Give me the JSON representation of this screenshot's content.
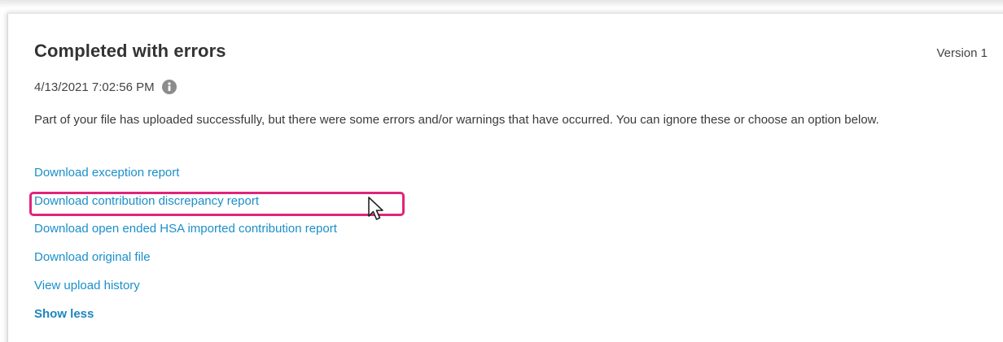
{
  "card": {
    "title": "Completed with errors",
    "version": "Version 1",
    "timestamp": "4/13/2021 7:02:56 PM",
    "info_icon": "info-circle-icon",
    "message": "Part of your file has uploaded successfully, but there were some errors and/or warnings that have occurred. You can ignore these or choose an option below."
  },
  "links": {
    "download_exception": "Download exception report",
    "download_discrepancy": "Download contribution discrepancy report",
    "download_hsa": "Download open ended HSA imported contribution report",
    "download_original": "Download original file",
    "view_history": "View upload history",
    "show_less": "Show less"
  },
  "colors": {
    "link": "#1a8fc9",
    "highlight": "#e0247a",
    "title": "#333333"
  }
}
